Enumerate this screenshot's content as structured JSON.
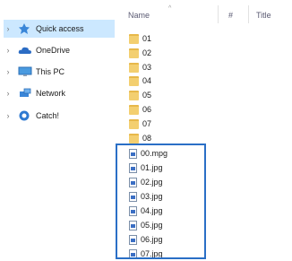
{
  "nav": {
    "items": [
      {
        "label": "Quick access",
        "icon": "quick-access-star-icon",
        "selected": true
      },
      {
        "label": "OneDrive",
        "icon": "onedrive-cloud-icon",
        "selected": false
      },
      {
        "label": "This PC",
        "icon": "this-pc-monitor-icon",
        "selected": false
      },
      {
        "label": "Network",
        "icon": "network-icon",
        "selected": false
      },
      {
        "label": "Catch!",
        "icon": "catch-app-icon",
        "selected": false
      }
    ]
  },
  "columns": {
    "name": "Name",
    "number": "#",
    "title": "Title"
  },
  "folders": [
    "01",
    "02",
    "03",
    "04",
    "05",
    "06",
    "07",
    "08"
  ],
  "files": [
    "00.mpg",
    "01.jpg",
    "02.jpg",
    "03.jpg",
    "04.jpg",
    "05.jpg",
    "06.jpg",
    "07.jpg"
  ],
  "colors": {
    "selected_bg": "#cce8ff",
    "highlight_border": "#2a6fc6",
    "folder": "#f3cf70"
  }
}
